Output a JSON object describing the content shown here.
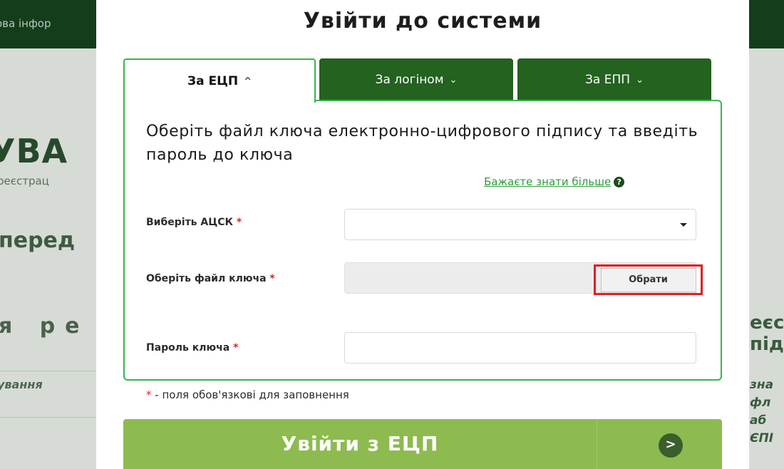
{
  "background": {
    "topbar_text": "ова інфор",
    "heading": "УВА",
    "subtext": "реєстрац",
    "bold_text": "перед",
    "row_text": "я ре",
    "italic_text": "ування",
    "right_big_1": "еєс",
    "right_big_2": "під",
    "right_italic_1": "зна",
    "right_italic_2": "фл",
    "right_italic_3": "аб",
    "right_italic_4": "ЄПІ"
  },
  "modal": {
    "title": "Увійти до системи",
    "tabs": [
      {
        "label": "За ЕЦП",
        "icon": "chevron-up-icon",
        "chevron": "^",
        "active": true
      },
      {
        "label": "За логіном",
        "icon": "chevron-down-icon",
        "chevron": "⌄",
        "active": false
      },
      {
        "label": "За ЕПП",
        "icon": "chevron-down-icon",
        "chevron": "⌄",
        "active": false
      }
    ],
    "instruction": "Оберіть файл ключа електронно-цифрового підпису та введіть пароль до ключа",
    "learn_more": "Бажаєте знати більше",
    "help_icon": "question-circle-icon",
    "help_glyph": "?",
    "fields": {
      "acsk_label": "Виберіть АЦСК",
      "acsk_value": "",
      "file_label": "Оберіть файл ключа",
      "file_value": "",
      "browse_button": "Обрати",
      "password_label": "Пароль ключа",
      "password_value": "",
      "required_mark": "*"
    },
    "required_note": "- поля обов'язкові для заповнення",
    "submit_label": "Увійти з ЕЦП",
    "submit_icon": "chevron-right-circle-icon",
    "submit_glyph": ">",
    "colors": {
      "tab_inactive": "#23621f",
      "panel_border": "#3ab54a",
      "submit": "#8dbb4f",
      "required": "#e02020",
      "highlight": "#e01f1f"
    }
  }
}
